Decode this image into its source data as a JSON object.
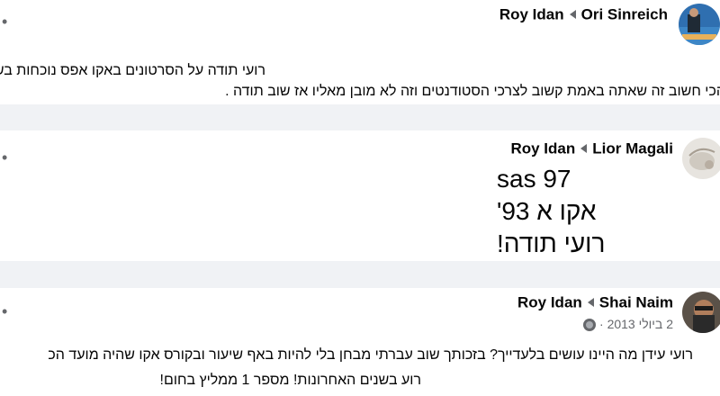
{
  "posts": [
    {
      "author": "Roy Idan",
      "recipient": "Ori Sinreich",
      "lines": [
        "רועי תודה על הסרטונים באקו אפס נוכחות בשיעורים והקורס מאחוריי (;",
        "הכי חשוב זה שאתה באמת קשוב לצרכי הסטודנטים וזה לא מובן מאליו אז שוב תודה ."
      ]
    },
    {
      "author": "Roy Idan",
      "recipient": "Lior Magali",
      "lines": [
        "97 sas",
        "אקו א 93'",
        "רועי תודה!"
      ]
    },
    {
      "author": "Roy Idan",
      "recipient": "Shai Naim",
      "date": "2 ביולי 2013",
      "separator": "·",
      "lines": [
        "רועי עידן מה היינו עושים בלעדייך? בזכותך שוב עברתי מבחן בלי להיות באף שיעור ובקורס אקו שהיה מועד הכ",
        "רוע בשנים האחרונות! מספר 1 ממליץ בחום!"
      ]
    }
  ],
  "menu_glyph": "•"
}
